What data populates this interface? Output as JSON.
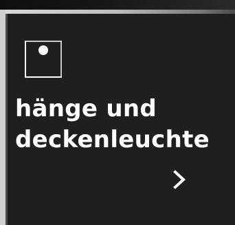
{
  "tile": {
    "icon": "lamp-box-icon",
    "title_line1": "hänge und",
    "title_line2": "deckenleuchte",
    "link_icon": "chevron-right-icon",
    "colors": {
      "background": "#1f1f1f",
      "text": "#ffffff",
      "border": "#cfcfcf"
    }
  }
}
